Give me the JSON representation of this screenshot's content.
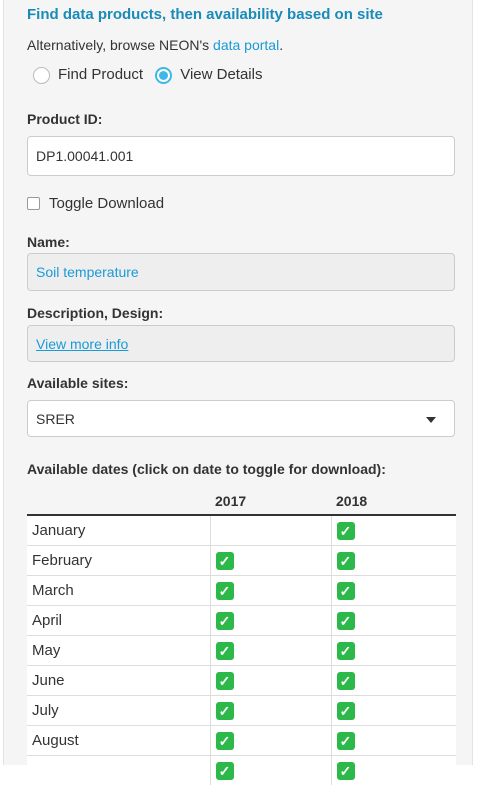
{
  "header": {
    "title": "Find data products, then availability based on site",
    "alt_prefix": "Alternatively, browse NEON's ",
    "alt_link": "data portal",
    "alt_suffix": "."
  },
  "mode": {
    "options": [
      "Find Product",
      "View Details"
    ],
    "selected": "View Details"
  },
  "product": {
    "label": "Product ID:",
    "value": "DP1.00041.001"
  },
  "toggle_download": {
    "label": "Toggle Download",
    "checked": false
  },
  "name": {
    "label": "Name:",
    "value": "Soil temperature"
  },
  "description": {
    "label": "Description, Design:",
    "link": "View more info"
  },
  "sites": {
    "label": "Available sites:",
    "selected": "SRER"
  },
  "dates": {
    "label": "Available dates (click on date to toggle for download):",
    "columns": [
      "",
      "2017",
      "2018"
    ],
    "rows": [
      {
        "month": "January",
        "y2017": false,
        "y2018": true
      },
      {
        "month": "February",
        "y2017": true,
        "y2018": true
      },
      {
        "month": "March",
        "y2017": true,
        "y2018": true
      },
      {
        "month": "April",
        "y2017": true,
        "y2018": true
      },
      {
        "month": "May",
        "y2017": true,
        "y2018": true
      },
      {
        "month": "June",
        "y2017": true,
        "y2018": true
      },
      {
        "month": "July",
        "y2017": true,
        "y2018": true
      },
      {
        "month": "August",
        "y2017": true,
        "y2018": true
      },
      {
        "month": "",
        "y2017": true,
        "y2018": true
      }
    ],
    "check_color": "#2db84a"
  }
}
